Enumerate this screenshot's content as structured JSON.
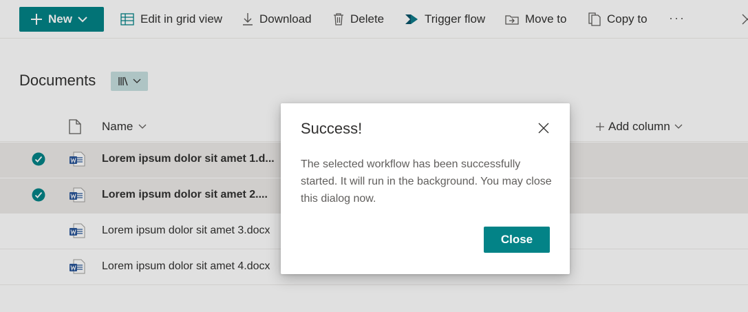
{
  "colors": {
    "accent": "#038387",
    "selected_row": "#edebe9",
    "word_blue": "#2b579a"
  },
  "commandbar": {
    "new_label": "New",
    "edit_grid_label": "Edit in grid view",
    "download_label": "Download",
    "delete_label": "Delete",
    "trigger_flow_label": "Trigger flow",
    "move_to_label": "Move to",
    "copy_to_label": "Copy to",
    "more_label": "···",
    "icons": [
      "plus-icon",
      "chevron-down-icon",
      "grid-icon",
      "download-icon",
      "trash-icon",
      "flow-icon",
      "move-icon",
      "copy-icon",
      "more-icon",
      "close-icon"
    ]
  },
  "library": {
    "title": "Documents",
    "view_icon": "library-view-icon"
  },
  "list": {
    "columns": {
      "name": "Name",
      "add_column": "Add column"
    },
    "rows": [
      {
        "name": "Lorem ipsum dolor sit amet 1.d...",
        "selected": true
      },
      {
        "name": "Lorem ipsum dolor sit amet 2....",
        "selected": true
      },
      {
        "name": "Lorem ipsum dolor sit amet 3.docx",
        "selected": false
      },
      {
        "name": "Lorem ipsum dolor sit amet 4.docx",
        "selected": false
      }
    ]
  },
  "dialog": {
    "title": "Success!",
    "message": "The selected workflow has been successfully started. It will run in the background. You may close this dialog now.",
    "close_button": "Close"
  }
}
